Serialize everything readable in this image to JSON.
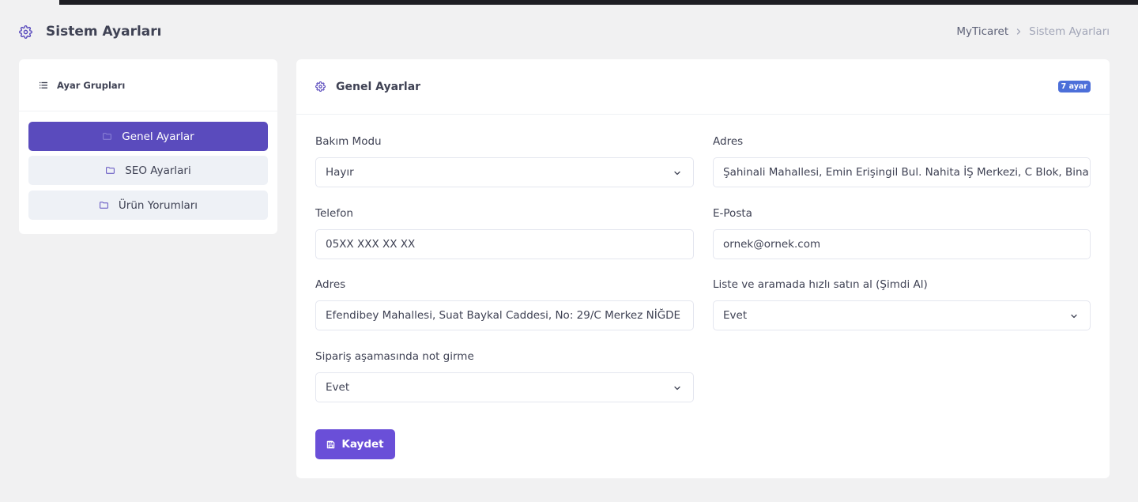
{
  "page": {
    "title": "Sistem Ayarları",
    "breadcrumb": {
      "home": "MyTicaret",
      "current": "Sistem Ayarları"
    },
    "icon": "gear-icon",
    "accent": "#5a4bbd"
  },
  "sidebar": {
    "title": "Ayar Grupları",
    "items": [
      {
        "label": "Genel Ayarlar",
        "icon": "folder-icon",
        "active": true
      },
      {
        "label": "SEO Ayarlari",
        "icon": "folder-icon",
        "active": false
      },
      {
        "label": "Ürün Yorumları",
        "icon": "folder-icon",
        "active": false
      }
    ]
  },
  "main": {
    "title": "Genel Ayarlar",
    "badge": "7 ayar",
    "fields": [
      {
        "label": "Bakım Modu",
        "value": "Hayır",
        "type": "select"
      },
      {
        "label": "Adres",
        "value": "Şahinali Mahallesi, Emin Erişingil Bul. Nahita İŞ Merkezi, C Blok, Bina No",
        "type": "text"
      },
      {
        "label": "Telefon",
        "value": "05XX XXX XX XX",
        "type": "text"
      },
      {
        "label": "E-Posta",
        "value": "ornek@ornek.com",
        "type": "text"
      },
      {
        "label": "Adres",
        "value": "Efendibey Mahallesi, Suat Baykal Caddesi, No: 29/C Merkez NİĞDE",
        "type": "text"
      },
      {
        "label": "Liste ve aramada hızlı satın al (Şimdi Al)",
        "value": "Evet",
        "type": "select"
      },
      {
        "label": "Sipariş aşamasında not girme",
        "value": "Evet",
        "type": "select"
      }
    ],
    "save_label": "Kaydet"
  }
}
